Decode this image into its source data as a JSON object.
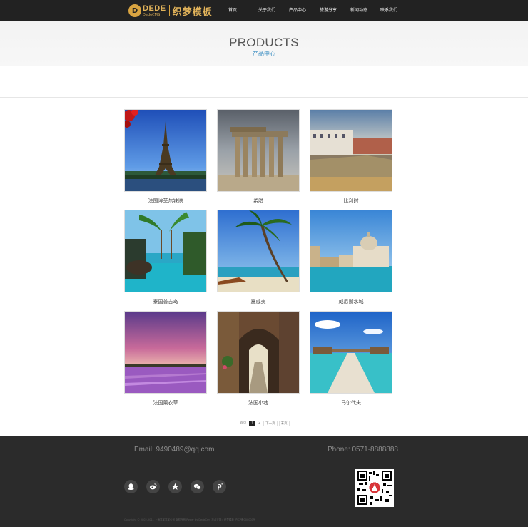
{
  "header": {
    "logo": {
      "badge": "D",
      "brand_en": "DEDE",
      "brand_en_sub": "DedeCMS",
      "brand_cn": "织梦模板"
    },
    "nav": [
      "首页",
      "关于我们",
      "产品中心",
      "旅游分享",
      "新闻动态",
      "联系我们"
    ]
  },
  "banner": {
    "title": "PRODUCTS",
    "subtitle": "产品中心"
  },
  "products": [
    {
      "name": "法国埃菲尔铁塔"
    },
    {
      "name": "希腊"
    },
    {
      "name": "比利时"
    },
    {
      "name": "泰国普吉岛"
    },
    {
      "name": "夏威夷"
    },
    {
      "name": "威尼斯水城"
    },
    {
      "name": "法国薰衣草"
    },
    {
      "name": "法国小巷"
    },
    {
      "name": "马尔代夫"
    }
  ],
  "pagination": {
    "first": "首页",
    "page1": "1",
    "page2": "2",
    "next": "下一页",
    "last": "末页"
  },
  "footer": {
    "email": "Email: 9490489@qq.com",
    "phone": "Phone: 0571-8888888",
    "socials": [
      "qq-icon",
      "weibo-icon",
      "star-icon",
      "wechat-icon",
      "pinterest-icon"
    ],
    "copyright": "Copyright © 2002-2011 上海某某某某公司 版权所有 Power by DedeCms 技术支持：织梦模板 沪ICP备000001号"
  },
  "colors": {
    "header_bg": "#222222",
    "logo_gold": "#d9a441",
    "subtitle_blue": "#3b8ec2",
    "footer_bg": "#2b2b2b"
  }
}
